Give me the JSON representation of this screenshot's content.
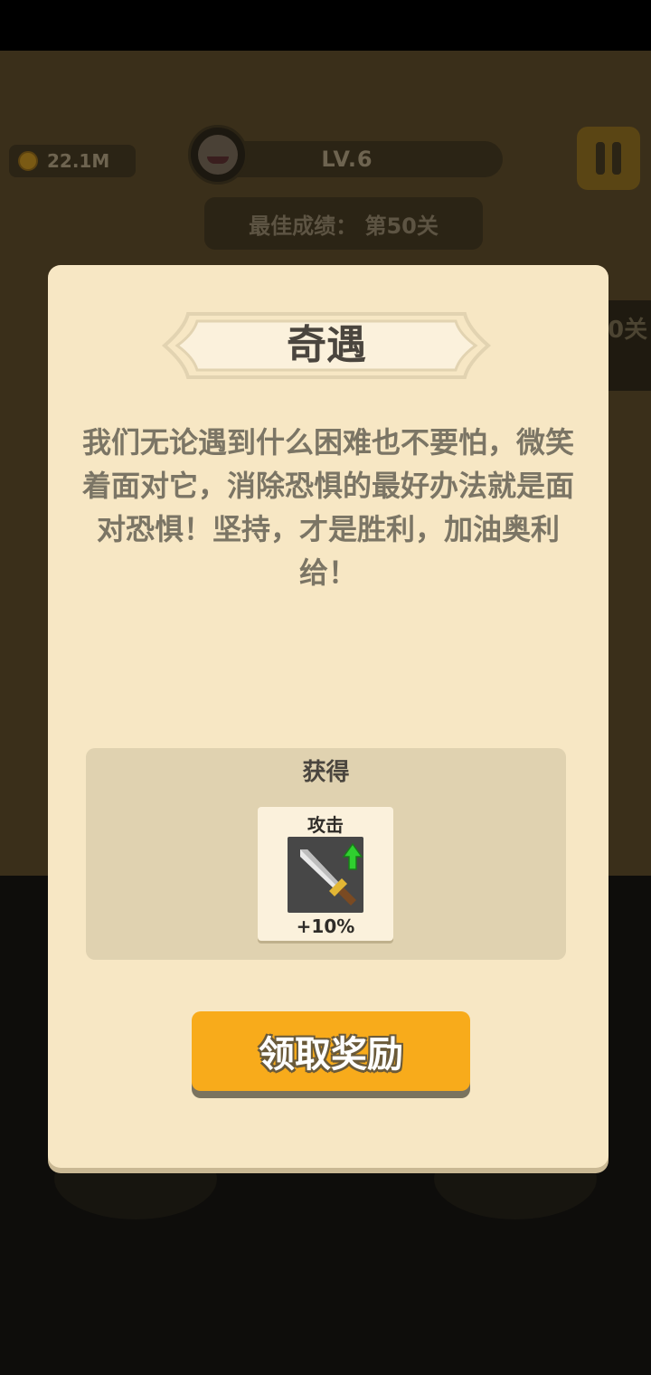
{
  "hud": {
    "coins": "22.1M",
    "level": "LV.6",
    "best_score": "最佳成绩：  第50关",
    "side_partial": "0关"
  },
  "modal": {
    "title": "奇遇",
    "story": "我们无论遇到什么困难也不要怕，微笑着面对它，消除恐惧的最好办法就是面对恐惧！坚持，才是胜利，加油奥利给！",
    "reward_heading": "获得",
    "reward_item": {
      "label": "攻击",
      "value": "+10%",
      "icon": "sword-icon"
    },
    "claim_button": "领取奖励"
  },
  "colors": {
    "modal_bg": "#f7e7c4",
    "button": "#f8ab1b",
    "reward_panel": "#e0d2b0"
  }
}
